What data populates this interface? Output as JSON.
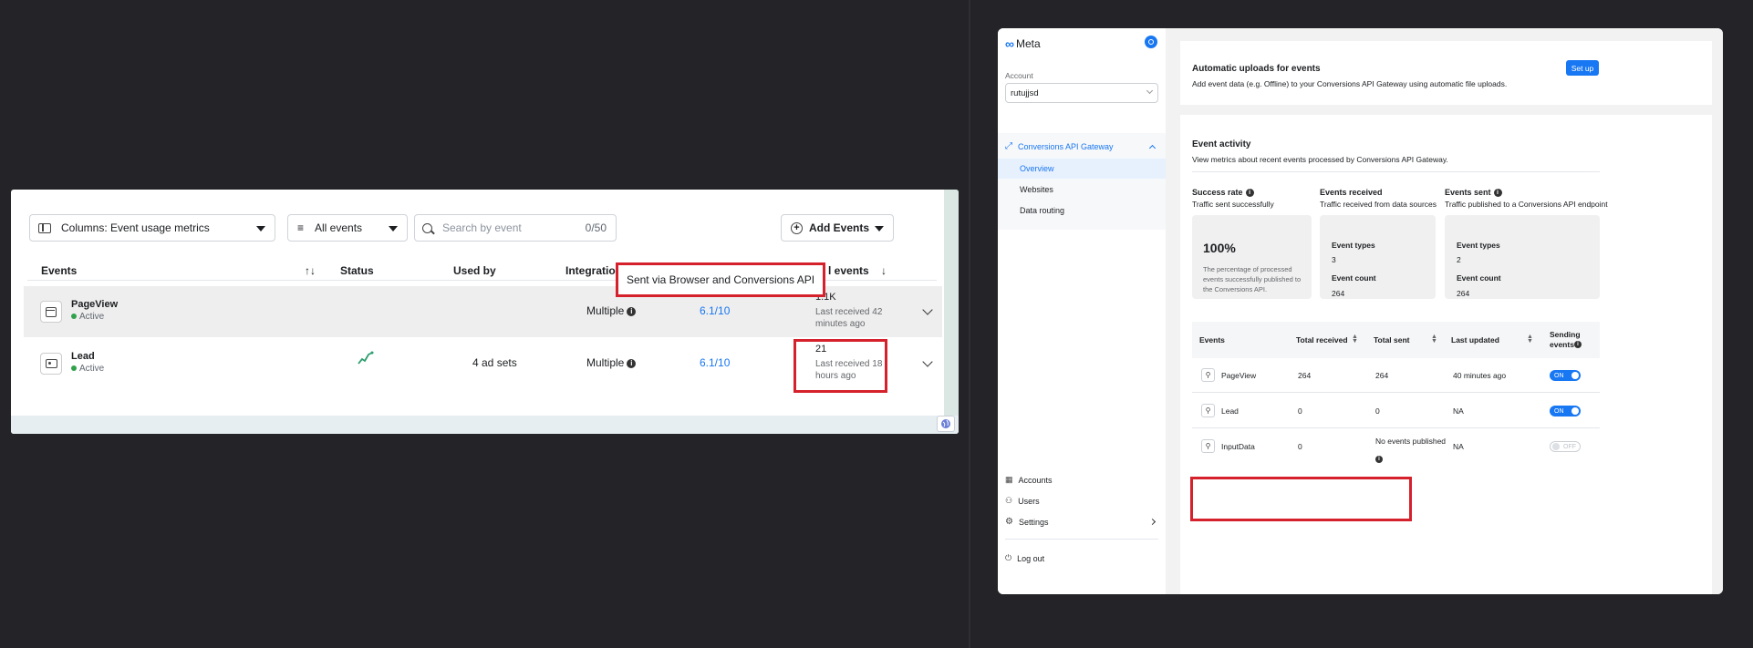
{
  "left_panel": {
    "columns_select": "Columns: Event usage metrics",
    "filter_select": "All events",
    "search": {
      "placeholder": "Search by event",
      "count": "0/50"
    },
    "add_events_label": "Add Events",
    "headers": {
      "events": "Events",
      "sort": "↑↓",
      "status": "Status",
      "used_by": "Used by",
      "integration": "Integratio",
      "total_events": "l events",
      "total_sort": "↓"
    },
    "tooltip": "Sent via Browser and Conversions API",
    "rows": [
      {
        "name": "PageView",
        "status": "Active",
        "used_by": "",
        "integration": "Multiple",
        "version": "6.1/10",
        "total": "1.1K",
        "last_received": "Last received 42 minutes ago"
      },
      {
        "name": "Lead",
        "status": "Active",
        "used_by": "4 ad sets",
        "integration": "Multiple",
        "version": "6.1/10",
        "total": "21",
        "last_received": "Last received 18 hours ago"
      }
    ]
  },
  "right_panel": {
    "brand": "Meta",
    "sidebar": {
      "account_label": "Account",
      "account_value": "rutujjsd",
      "section": "Conversions API Gateway",
      "items": [
        "Overview",
        "Websites",
        "Data routing"
      ],
      "bottom_items": [
        "Accounts",
        "Users",
        "Settings"
      ],
      "logout": "Log out"
    },
    "auto_uploads": {
      "title": "Automatic uploads for events",
      "desc": "Add event data (e.g. Offline) to your Conversions API Gateway using automatic file uploads.",
      "button": "Set up"
    },
    "event_activity": {
      "title": "Event activity",
      "desc": "View metrics about recent events processed by Conversions API Gateway.",
      "metrics": [
        {
          "label": "Success rate",
          "sub": "Traffic sent successfully",
          "big": "100%",
          "note": "The percentage of processed events successfully published to the Conversions API."
        },
        {
          "label": "Events received",
          "sub": "Traffic received from data sources",
          "types_label": "Event types",
          "types": "3",
          "count_label": "Event count",
          "count": "264"
        },
        {
          "label": "Events sent",
          "sub": "Traffic published to a Conversions API endpoint",
          "types_label": "Event types",
          "types": "2",
          "count_label": "Event count",
          "count": "264"
        }
      ],
      "table_headers": {
        "events": "Events",
        "total_received": "Total received",
        "total_sent": "Total sent",
        "last_updated": "Last updated",
        "sending": "Sending events"
      },
      "rows": [
        {
          "name": "PageView",
          "received": "264",
          "sent": "264",
          "updated": "40 minutes ago",
          "toggle": "ON"
        },
        {
          "name": "Lead",
          "received": "0",
          "sent": "0",
          "updated": "NA",
          "toggle": "ON"
        },
        {
          "name": "InputData",
          "received": "0",
          "sent": "No events published",
          "updated": "NA",
          "toggle": "OFF"
        }
      ]
    }
  },
  "colors": {
    "accent": "#1877f2",
    "highlight": "#d5212b",
    "active": "#31a24c"
  }
}
